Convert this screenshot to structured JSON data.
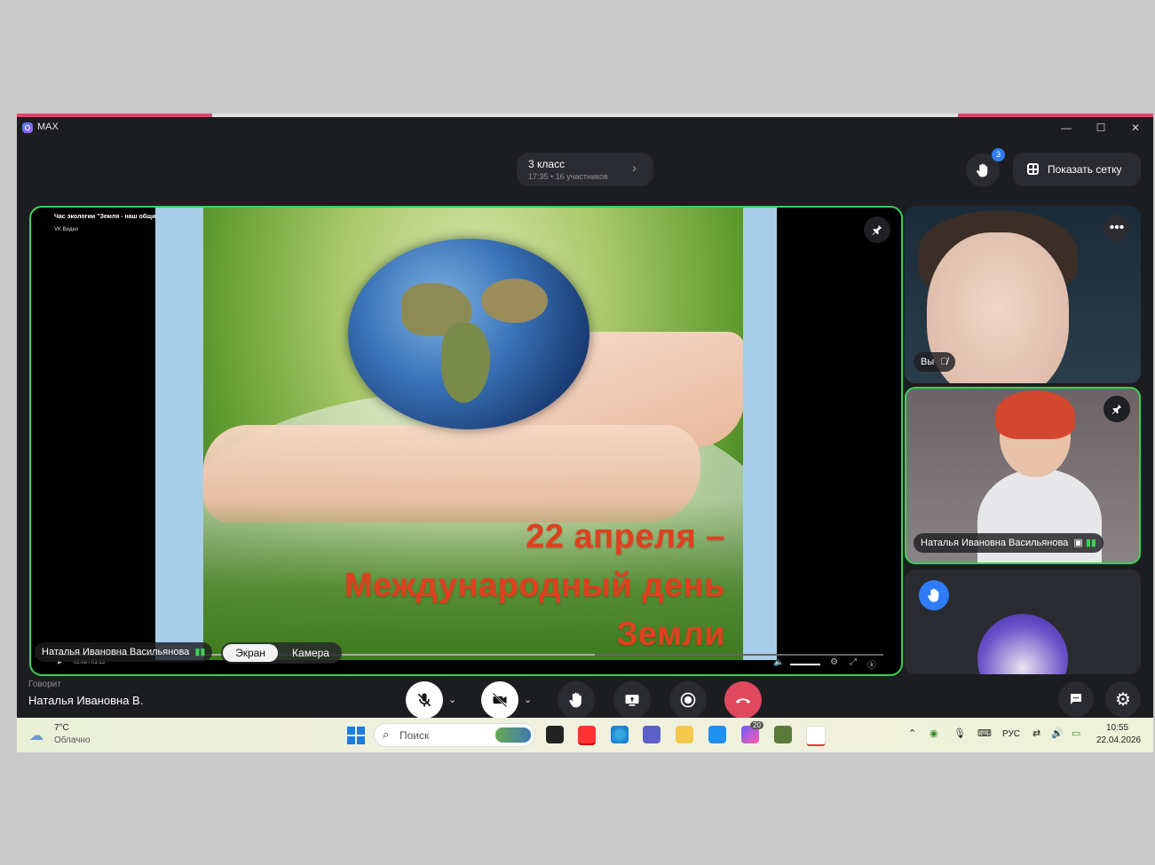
{
  "app": {
    "title": "MAX"
  },
  "window_controls": {
    "minimize": "—",
    "maximize": "☐",
    "close": "✕"
  },
  "call": {
    "title": "3 класс",
    "subtitle": "17:35 • 16 участников",
    "raised_hands": "3"
  },
  "grid_button": {
    "label": "Показать сетку"
  },
  "stage": {
    "video_title": "Час экологии \"Земля - наш общий дом\"",
    "video_source": "VK Видео",
    "slide_line1": "22 апреля –",
    "slide_line2": "Международный день",
    "slide_line3": "Земли",
    "presenter_name": "Наталья Ивановна Васильянова",
    "tabs": [
      {
        "label": "Экран",
        "active": true
      },
      {
        "label": "Камера",
        "active": false
      }
    ],
    "time": "02:08 / 03:13",
    "progress": 0.65
  },
  "participants": [
    {
      "name": "Вы",
      "muted": true
    },
    {
      "name": "Наталья Ивановна Васильянова",
      "speaking": true,
      "pinned": true
    },
    {
      "name": "",
      "hand_raised": true
    }
  ],
  "speaking": {
    "label": "Говорит",
    "name": "Наталья Ивановна В."
  },
  "taskbar": {
    "weather_temp": "7°C",
    "weather_desc": "Облачно",
    "search_placeholder": "Поиск",
    "lang": "РУС",
    "time": "10:55",
    "date": "22.04.2026",
    "badge": "20"
  },
  "colors": {
    "accent_green": "#3ccf55",
    "hangup_red": "#e0485e",
    "badge_blue": "#2f7cf6"
  }
}
